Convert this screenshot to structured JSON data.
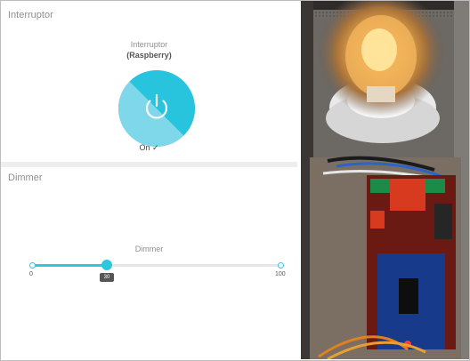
{
  "interruptor_panel": {
    "title": "Interruptor",
    "widget_label": "Interruptor",
    "widget_subtitle": "(Raspberry)",
    "state_text": "On ✓",
    "is_on": true,
    "icon": "power-icon",
    "colors": {
      "on_light": "#7fd8ea",
      "on_dark": "#28c3dd"
    }
  },
  "dimmer_panel": {
    "title": "Dimmer",
    "widget_label": "Dimmer",
    "min_label": "0",
    "max_label": "100",
    "value": 30,
    "value_label": "30",
    "min": 0,
    "max": 100,
    "accent_color": "#30c6dc"
  }
}
